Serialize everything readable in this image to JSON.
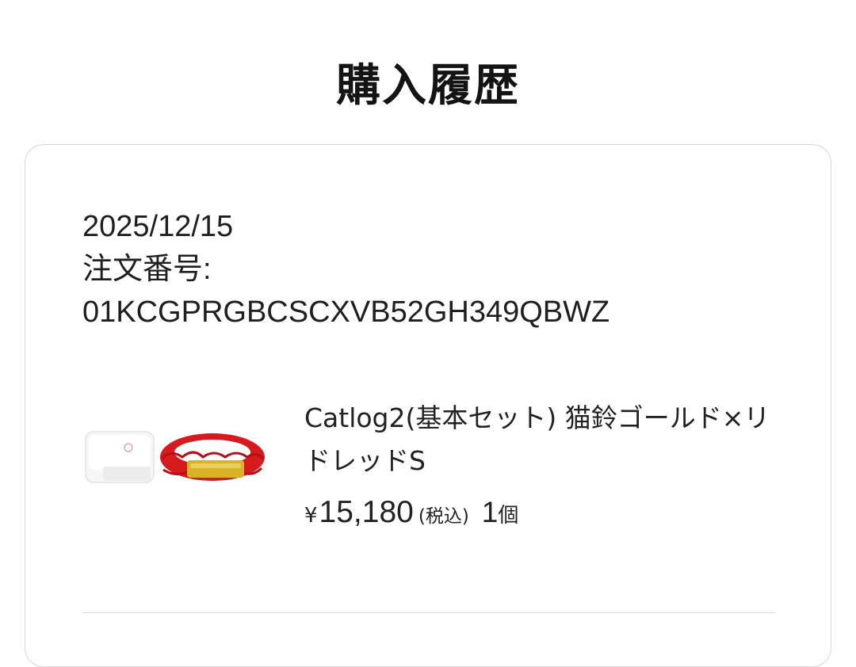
{
  "page": {
    "title": "購入履歴"
  },
  "order": {
    "date": "2025/12/15",
    "order_number_label": "注文番号:",
    "order_number": "01KCGPRGBCSCXVB52GH349QBWZ",
    "item": {
      "name": "Catlog2(基本セット) 猫鈴ゴールド×リドレッドS",
      "currency": "¥",
      "price": "15,180",
      "tax_note": "(税込)",
      "quantity": "1",
      "quantity_unit": "個",
      "image_icon": "product-thumbnail-icon"
    }
  },
  "colors": {
    "card_border": "#d9d6d3",
    "text": "#1a1a1a",
    "strap_red": "#d61a1e",
    "plate_gold": "#d9b226"
  }
}
